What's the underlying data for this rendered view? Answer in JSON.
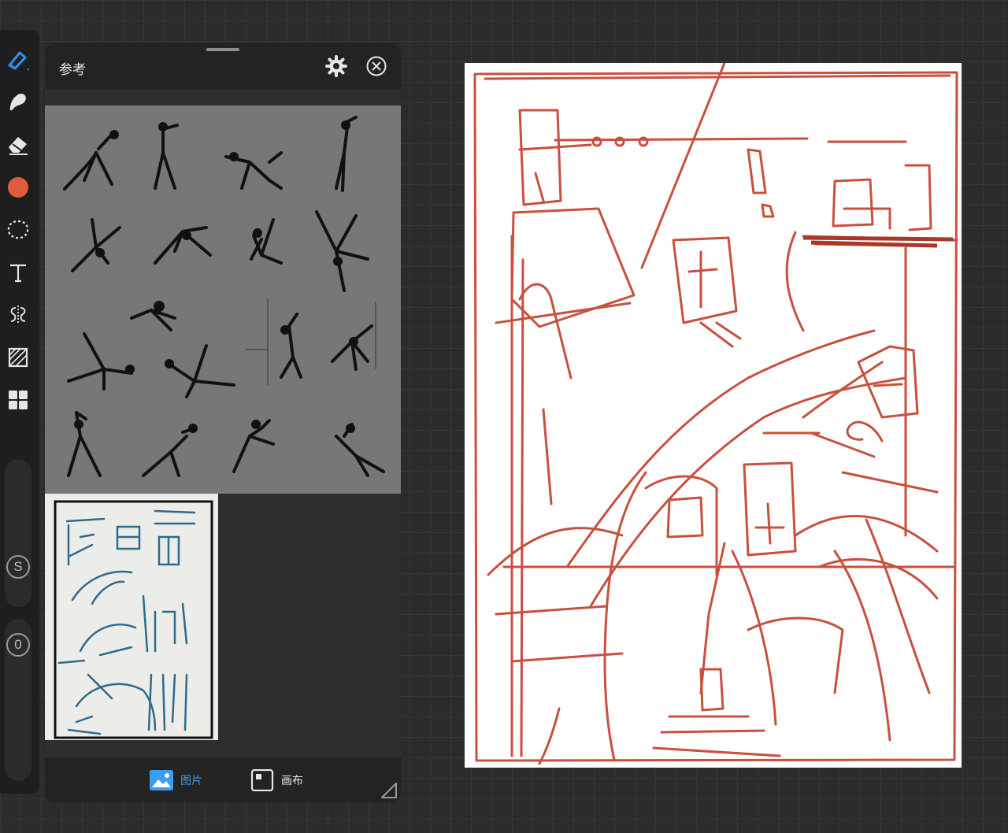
{
  "toolbar": {
    "tools": [
      {
        "name": "brush-tool",
        "icon": "brush-icon"
      },
      {
        "name": "smudge-tool",
        "icon": "smudge-icon"
      },
      {
        "name": "eraser-tool",
        "icon": "eraser-icon"
      },
      {
        "name": "color-tool",
        "icon": "color-swatch-icon"
      },
      {
        "name": "selection-tool",
        "icon": "lasso-icon"
      },
      {
        "name": "text-tool",
        "icon": "text-icon"
      },
      {
        "name": "symmetry-tool",
        "icon": "symmetry-icon"
      },
      {
        "name": "layers-adjust-tool",
        "icon": "adjust-icon"
      },
      {
        "name": "gallery-tool",
        "icon": "grid-icon"
      }
    ],
    "size_slider_label": "S",
    "opacity_slider_label": "0",
    "accent_color": "#2f8ff0",
    "active_color": "#e05a3f"
  },
  "panel": {
    "title": "参考",
    "icons": {
      "settings": "gear-icon",
      "close": "close-circle-icon"
    },
    "tabs": [
      {
        "label": "图片",
        "icon": "image-icon",
        "active": true,
        "color": "#3a9cf5"
      },
      {
        "label": "画布",
        "icon": "canvas-icon",
        "active": false,
        "color": "#e6e6e6"
      }
    ]
  },
  "canvas": {
    "stroke_color": "#c8503e"
  }
}
